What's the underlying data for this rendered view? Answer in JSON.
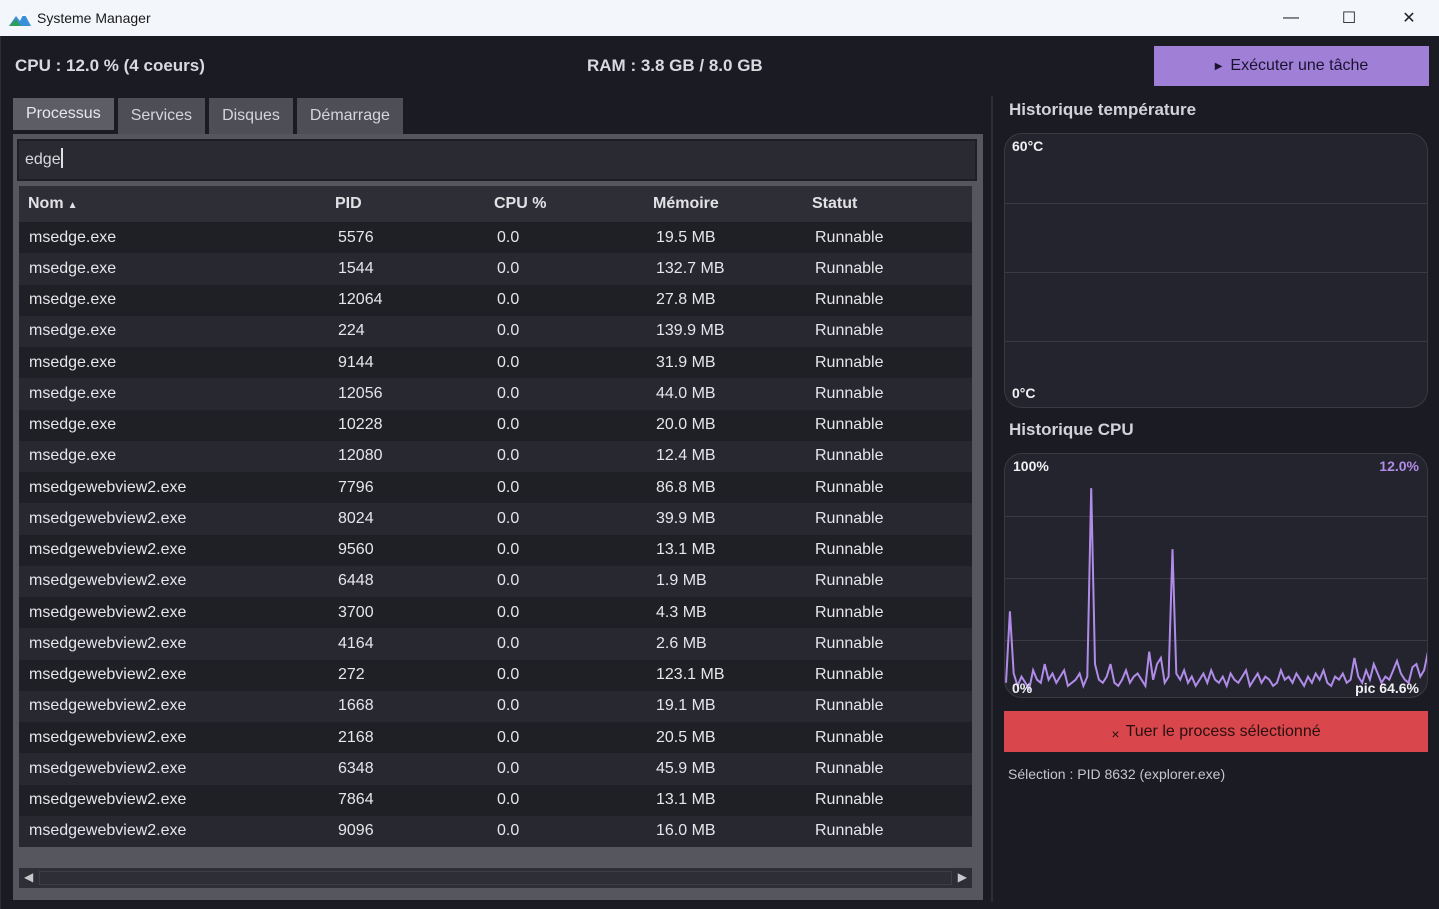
{
  "window": {
    "title": "Systeme Manager",
    "controls": {
      "minimize": "—",
      "maximize": "☐",
      "close": "✕"
    }
  },
  "header": {
    "cpu_text": "CPU : 12.0 % (4 coeurs)",
    "ram_text": "RAM : 3.8 GB / 8.0 GB",
    "exec_button": "Exécuter une tâche"
  },
  "tabs": [
    {
      "label": "Processus",
      "active": true
    },
    {
      "label": "Services",
      "active": false
    },
    {
      "label": "Disques",
      "active": false
    },
    {
      "label": "Démarrage",
      "active": false
    }
  ],
  "search": {
    "value": "edge"
  },
  "table": {
    "columns": [
      "Nom",
      "PID",
      "CPU %",
      "Mémoire",
      "Statut"
    ],
    "sort_indicator": "▲",
    "rows": [
      [
        "msedge.exe",
        "5576",
        "0.0",
        "19.5 MB",
        "Runnable"
      ],
      [
        "msedge.exe",
        "1544",
        "0.0",
        "132.7 MB",
        "Runnable"
      ],
      [
        "msedge.exe",
        "12064",
        "0.0",
        "27.8 MB",
        "Runnable"
      ],
      [
        "msedge.exe",
        "224",
        "0.0",
        "139.9 MB",
        "Runnable"
      ],
      [
        "msedge.exe",
        "9144",
        "0.0",
        "31.9 MB",
        "Runnable"
      ],
      [
        "msedge.exe",
        "12056",
        "0.0",
        "44.0 MB",
        "Runnable"
      ],
      [
        "msedge.exe",
        "10228",
        "0.0",
        "20.0 MB",
        "Runnable"
      ],
      [
        "msedge.exe",
        "12080",
        "0.0",
        "12.4 MB",
        "Runnable"
      ],
      [
        "msedgewebview2.exe",
        "7796",
        "0.0",
        "86.8 MB",
        "Runnable"
      ],
      [
        "msedgewebview2.exe",
        "8024",
        "0.0",
        "39.9 MB",
        "Runnable"
      ],
      [
        "msedgewebview2.exe",
        "9560",
        "0.0",
        "13.1 MB",
        "Runnable"
      ],
      [
        "msedgewebview2.exe",
        "6448",
        "0.0",
        "1.9 MB",
        "Runnable"
      ],
      [
        "msedgewebview2.exe",
        "3700",
        "0.0",
        "4.3 MB",
        "Runnable"
      ],
      [
        "msedgewebview2.exe",
        "4164",
        "0.0",
        "2.6 MB",
        "Runnable"
      ],
      [
        "msedgewebview2.exe",
        "272",
        "0.0",
        "123.1 MB",
        "Runnable"
      ],
      [
        "msedgewebview2.exe",
        "1668",
        "0.0",
        "19.1 MB",
        "Runnable"
      ],
      [
        "msedgewebview2.exe",
        "2168",
        "0.0",
        "20.5 MB",
        "Runnable"
      ],
      [
        "msedgewebview2.exe",
        "6348",
        "0.0",
        "45.9 MB",
        "Runnable"
      ],
      [
        "msedgewebview2.exe",
        "7864",
        "0.0",
        "13.1 MB",
        "Runnable"
      ],
      [
        "msedgewebview2.exe",
        "9096",
        "0.0",
        "16.0 MB",
        "Runnable"
      ]
    ]
  },
  "temp_chart": {
    "title": "Historique température",
    "max_label": "60°C",
    "min_label": "0°C"
  },
  "cpu_chart": {
    "title": "Historique CPU",
    "max_label": "100%",
    "min_label": "0%",
    "current_label": "12.0%",
    "peak_label": "pic 64.6%",
    "line_color": "#b08ce8"
  },
  "chart_data": {
    "type": "line",
    "title": "Historique CPU",
    "ylim": [
      0,
      100
    ],
    "series": [
      {
        "values": [
          2,
          25,
          5,
          1,
          4,
          2,
          0,
          6,
          3,
          2,
          8,
          3,
          5,
          2,
          4,
          6,
          1,
          2,
          3,
          5,
          1,
          4,
          64.6,
          8,
          3,
          2,
          4,
          8,
          2,
          1,
          3,
          6,
          2,
          4,
          5,
          3,
          1,
          12,
          3,
          8,
          10,
          2,
          4,
          45,
          5,
          3,
          6,
          2,
          4,
          1,
          3,
          5,
          2,
          6,
          3,
          2,
          4,
          1,
          5,
          3,
          2,
          4,
          6,
          1,
          3,
          5,
          2,
          4,
          3,
          1,
          2,
          6,
          3,
          4,
          2,
          5,
          3,
          1,
          4,
          2,
          5,
          3,
          6,
          2,
          1,
          4,
          3,
          5,
          2,
          3,
          10,
          4,
          2,
          6,
          3,
          8,
          5,
          2,
          4,
          3,
          6,
          9,
          5,
          3,
          2,
          7,
          8,
          4,
          6,
          12
        ]
      }
    ]
  },
  "kill_button": {
    "label": "Tuer le process sélectionné",
    "icon": "×"
  },
  "selection_text": "Sélection : PID 8632 (explorer.exe)",
  "colors": {
    "accent_purple": "#a07fd6",
    "danger_red": "#d9474c"
  }
}
